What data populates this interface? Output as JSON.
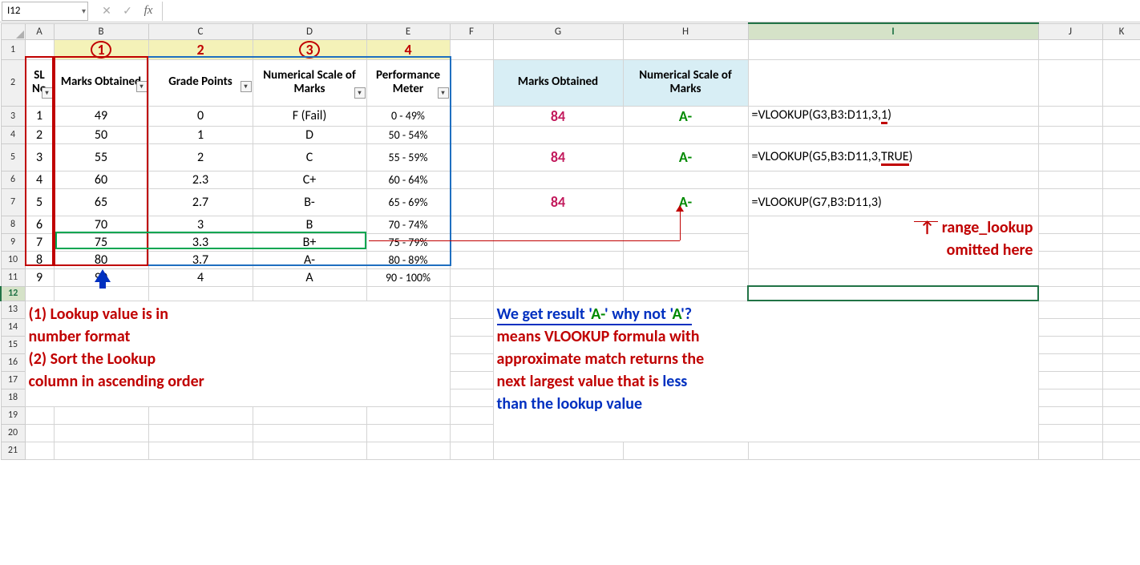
{
  "nameBox": "I12",
  "cols": [
    "A",
    "B",
    "C",
    "D",
    "E",
    "F",
    "G",
    "H",
    "I",
    "J",
    "K"
  ],
  "rows": [
    "1",
    "2",
    "3",
    "4",
    "5",
    "6",
    "7",
    "8",
    "9",
    "10",
    "11",
    "12",
    "13",
    "14",
    "15",
    "16",
    "17",
    "18",
    "19",
    "20",
    "21"
  ],
  "selected": {
    "row": "12",
    "col": "I"
  },
  "row1": {
    "n1": "1",
    "n2": "2",
    "n3": "3",
    "n4": "4"
  },
  "leftHeaders": {
    "a": "SL No",
    "b": "Marks Obtained",
    "c": "Grade Points",
    "d": "Numerical Scale of Marks",
    "e": "Performance Meter"
  },
  "leftData": [
    {
      "sl": "1",
      "marks": "49",
      "gp": "0",
      "num": "F (Fail)",
      "pm": "0 - 49%"
    },
    {
      "sl": "2",
      "marks": "50",
      "gp": "1",
      "num": "D",
      "pm": "50 - 54%"
    },
    {
      "sl": "3",
      "marks": "55",
      "gp": "2",
      "num": "C",
      "pm": "55 - 59%"
    },
    {
      "sl": "4",
      "marks": "60",
      "gp": "2.3",
      "num": "C+",
      "pm": "60 - 64%"
    },
    {
      "sl": "5",
      "marks": "65",
      "gp": "2.7",
      "num": "B-",
      "pm": "65 - 69%"
    },
    {
      "sl": "6",
      "marks": "70",
      "gp": "3",
      "num": "B",
      "pm": "70 - 74%"
    },
    {
      "sl": "7",
      "marks": "75",
      "gp": "3.3",
      "num": "B+",
      "pm": "75 - 79%"
    },
    {
      "sl": "8",
      "marks": "80",
      "gp": "3.7",
      "num": "A-",
      "pm": "80 - 89%"
    },
    {
      "sl": "9",
      "marks": "90",
      "gp": "4",
      "num": "A",
      "pm": "90 - 100%"
    }
  ],
  "rightHeaders": {
    "g": "Marks Obtained",
    "h": "Numerical Scale of Marks"
  },
  "results": [
    {
      "g": "84",
      "h": "A-",
      "formula_pre": "=VLOOKUP(G3,B3:D11,3,",
      "formula_u": "1",
      "formula_post": ")"
    },
    {
      "g": "84",
      "h": "A-",
      "formula_pre": "=VLOOKUP(G5,B3:D11,3,",
      "formula_u": "TRUE",
      "formula_post": ")"
    },
    {
      "g": "84",
      "h": "A-",
      "formula_pre": "=VLOOKUP(G7,B3:D11,3)",
      "formula_u": "",
      "formula_post": ""
    }
  ],
  "note_range": {
    "a": "range_lookup",
    "b": "omitted here"
  },
  "note_left": {
    "l1": "(1) Lookup value is in",
    "l2": "number format",
    "l3": "(2) Sort the Lookup",
    "l4": "column in ascending order"
  },
  "note_right": {
    "r1a": "We get result '",
    "r1b": "A-",
    "r1c": "' why not '",
    "r1d": "A",
    "r1e": "'?",
    "r2": "means VLOOKUP formula with",
    "r3": "approximate match returns the",
    "r4a": "next largest value that is ",
    "r4b": "less",
    "r5": "than the lookup value"
  },
  "icons": {
    "cancel": "✕",
    "enter": "✓",
    "fx": "fx",
    "dd": "▾",
    "filter": "▾"
  }
}
